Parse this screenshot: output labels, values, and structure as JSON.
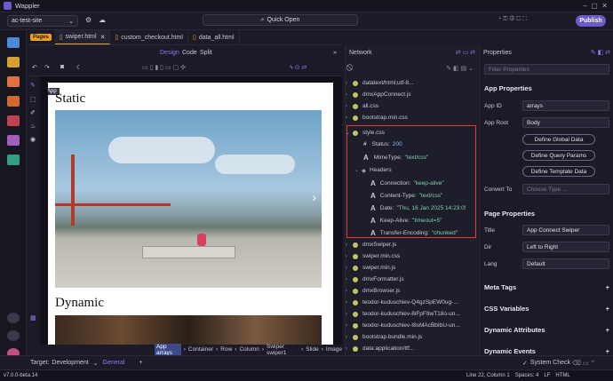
{
  "app": {
    "name": "Wappler"
  },
  "toolbar": {
    "site": "ac-test-site",
    "quick_open": "Quick Open",
    "publish": "Publish"
  },
  "tabs": {
    "pages_badge": "Pages",
    "items": [
      {
        "label": "swiper.html"
      },
      {
        "label": "custom_checkout.html"
      },
      {
        "label": "data_all.html"
      }
    ]
  },
  "editor": {
    "modes": [
      "Design",
      "Code",
      "Split"
    ],
    "tooltip": "App",
    "heading_static": "Static",
    "heading_dynamic": "Dynamic"
  },
  "breadcrumb": {
    "items": [
      "App arrays",
      "Container",
      "Row",
      "Column",
      "Swiper swiper1",
      "Slide",
      "Image"
    ]
  },
  "network": {
    "title": "Network",
    "files": [
      "datatext/html;utf-8...",
      "dmxAppConnect.js",
      "all.css",
      "bootstrap.min.css",
      "style.css"
    ],
    "details": {
      "status_label": "Status:",
      "status_value": "200",
      "mime_label": "MimeType:",
      "mime_value": "\"text/css\"",
      "headers_label": "Headers",
      "headers": [
        {
          "label": "Connection:",
          "value": "\"keep-alive\""
        },
        {
          "label": "Content-Type:",
          "value": "\"text/css\""
        },
        {
          "label": "Date:",
          "value": "\"Thu, 16 Jan 2025 14:23:05..."
        },
        {
          "label": "Keep-Alive:",
          "value": "\"timeout=5\""
        },
        {
          "label": "Transfer-Encoding:",
          "value": "\"chunked\""
        }
      ]
    },
    "files_after": [
      "dmxSwiper.js",
      "swiper.min.css",
      "swiper.min.js",
      "dmxFormatter.js",
      "dmxBrowser.js",
      "teodor-kuduschiev-Q4gzSpEW0ug-...",
      "teodor-kuduschiev-8iFpF9wT18o-un...",
      "teodor-kuduschiev-I8sMAcBbIbU-un...",
      "bootstrap.bundle.min.js",
      "data:application/ttf..."
    ]
  },
  "properties": {
    "title": "Properties",
    "filter_placeholder": "Filter Properties",
    "app_section": "App Properties",
    "app_id_label": "App ID",
    "app_id_value": "arrays",
    "app_root_label": "App Root",
    "app_root_value": "Body",
    "btn_global": "Define Global Data",
    "btn_query": "Define Query Params",
    "btn_template": "Define Template Data",
    "convert_label": "Convert To",
    "convert_placeholder": "Choose Type ...",
    "page_section": "Page Properties",
    "title_label": "Title",
    "title_value": "App Connect Swiper",
    "dir_label": "Dir",
    "dir_value": "Left to Right",
    "lang_label": "Lang",
    "lang_value": "Default",
    "collapsed": [
      "Meta Tags",
      "CSS Variables",
      "Dynamic Attributes",
      "Dynamic Events"
    ]
  },
  "bottom": {
    "target_label": "Target:",
    "target_value": "Development",
    "general": "General",
    "system_check": "System Check"
  },
  "status": {
    "version": "v7.0.0-beta.14",
    "line_col": "Line 22, Column 1",
    "spaces": "Spaces: 4",
    "eol": "LF",
    "lang": "HTML"
  },
  "colors": {
    "accent": "#6a5acd",
    "highlight": "#e53935",
    "string_value": "#7fd0b0",
    "number_value": "#8ab4f8"
  }
}
